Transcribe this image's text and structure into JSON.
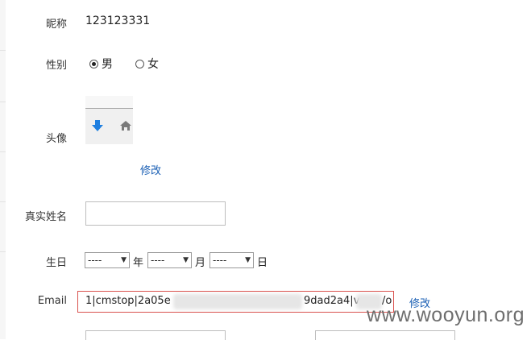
{
  "form": {
    "nickname": {
      "label": "昵称",
      "value": "123123331"
    },
    "gender": {
      "label": "性别",
      "options": [
        {
          "label": "男",
          "checked": true
        },
        {
          "label": "女",
          "checked": false
        }
      ]
    },
    "avatar": {
      "label": "头像",
      "edit_link": "修改",
      "icons": [
        "download-arrow-icon",
        "home-icon"
      ]
    },
    "realname": {
      "label": "真实姓名",
      "value": ""
    },
    "birthday": {
      "label": "生日",
      "year": {
        "selected": "----",
        "unit": "年"
      },
      "month": {
        "selected": "----",
        "unit": "月"
      },
      "day": {
        "selected": "----",
        "unit": "日"
      }
    },
    "email": {
      "label": "Email",
      "value_start": "1|cmstop|2a05e",
      "value_mid": "9dad2a4|v",
      "value_end": "/o",
      "edit_link": "修改"
    }
  },
  "watermark": "www.wooyun.org",
  "colors": {
    "link": "#1a5fb4",
    "error_border": "#d9534f"
  }
}
